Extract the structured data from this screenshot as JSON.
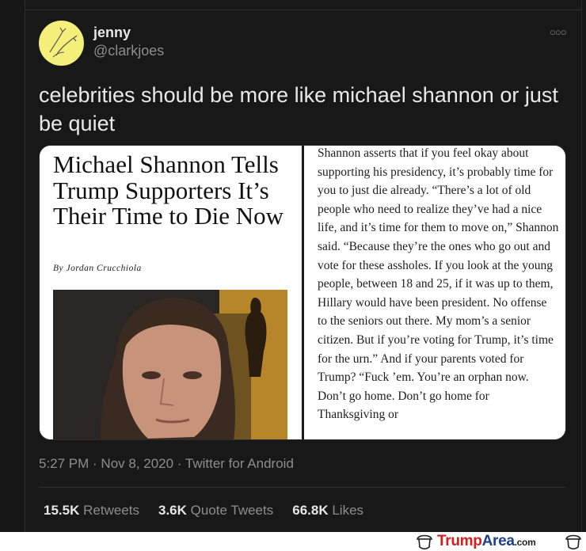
{
  "tweet": {
    "display_name": "jenny",
    "handle": "@clarkjoes",
    "more_icon": "more-horizontal-icon",
    "text": "celebrities should be more like michael shannon or just be quiet",
    "timestamp": "5:27 PM · Nov 8, 2020 · Twitter for Android",
    "stats": {
      "retweets_count": "15.5K",
      "retweets_label": "Retweets",
      "quotes_count": "3.6K",
      "quotes_label": "Quote Tweets",
      "likes_count": "66.8K",
      "likes_label": "Likes"
    }
  },
  "media": {
    "headline": "Michael Shannon Tells Trump Supporters It’s Their Time to Die Now",
    "byline_prefix": "By",
    "byline_author": "Jordan Crucchiola",
    "article_text": "Shannon asserts that if you feel okay about supporting his presidency, it’s probably time for you to just die already. “There’s a lot of old people who need to realize they’ve had a nice life, and it’s time for them to move on,” Shannon said. “Because they’re the ones who go out and vote for these assholes. If you look at the young people, between 18 and 25, if it was up to them, Hillary would have been president. No offense to the seniors out there. My mom’s a senior citizen. But if you’re voting for Trump, it’s time for the urn.” And if your parents voted for Trump? “Fuck ’em. You’re an orphan now. Don’t go home. Don’t go home for Thanksgiving or"
  },
  "watermark": {
    "brand_red": "Trump",
    "brand_blue": "Area",
    "brand_suffix": ".com"
  },
  "colors": {
    "background": "#171717",
    "text_primary": "#e9e9e9",
    "text_secondary": "#8d8d8d",
    "avatar_bg": "#f4ee7a",
    "watermark_red": "#d11f1f",
    "watermark_blue": "#1f3f8f"
  }
}
